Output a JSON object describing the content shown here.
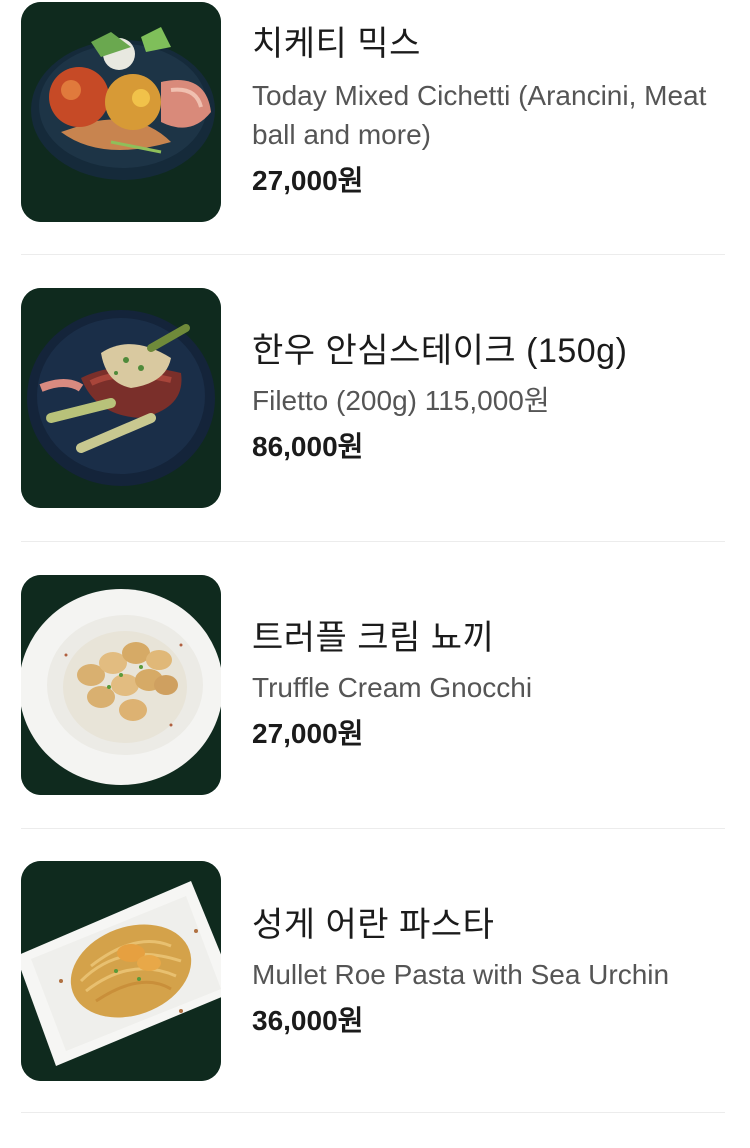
{
  "menu": {
    "items": [
      {
        "name": "치케티 믹스",
        "description": "Today Mixed Cichetti (Arancini, Meat ball and more)",
        "price": "27,000원",
        "image_icon": "mixed-cichetti-photo"
      },
      {
        "name": "한우 안심스테이크 (150g)",
        "description": "Filetto (200g) 115,000원",
        "price": "86,000원",
        "image_icon": "steak-photo"
      },
      {
        "name": "트러플 크림 뇨끼",
        "description": "Truffle Cream Gnocchi",
        "price": "27,000원",
        "image_icon": "gnocchi-photo"
      },
      {
        "name": "성게 어란 파스타",
        "description": "Mullet Roe Pasta with Sea Urchin",
        "price": "36,000원",
        "image_icon": "pasta-photo"
      }
    ]
  },
  "colors": {
    "photo_background": "#0f2a1e",
    "text_primary": "#1b1b1b",
    "text_secondary": "#555555",
    "divider": "#ececec"
  }
}
